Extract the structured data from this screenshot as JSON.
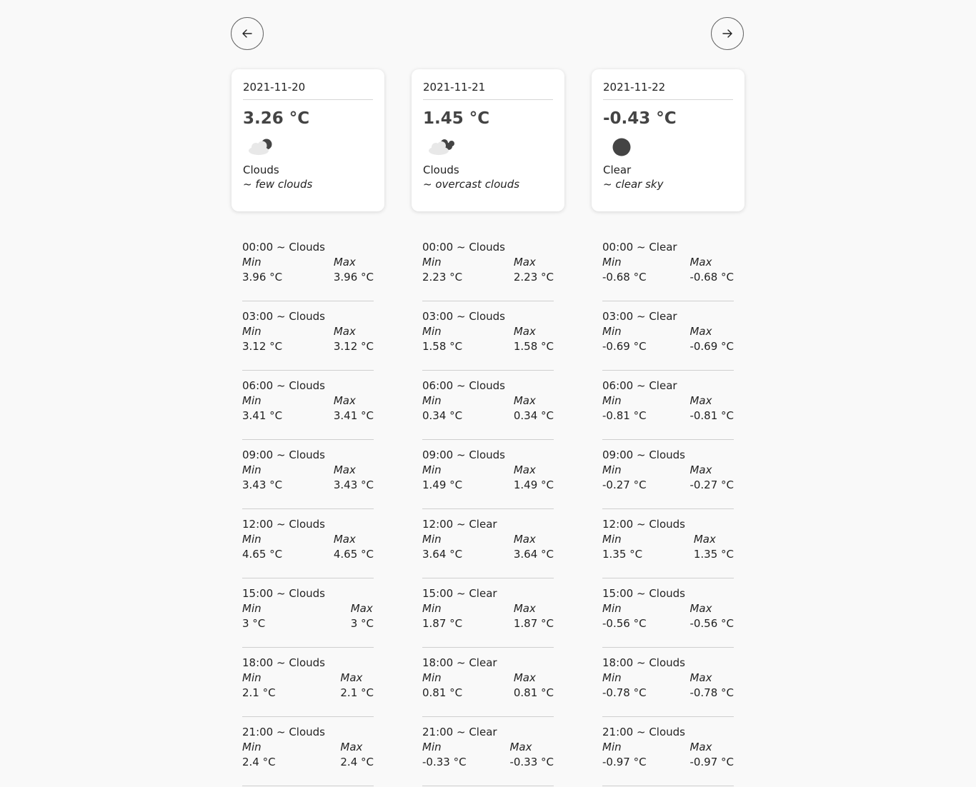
{
  "nav": {
    "prev_icon": "arrow-left-icon",
    "next_icon": "arrow-right-icon"
  },
  "days": [
    {
      "date": "2021-11-20",
      "temp": "3.26 °C",
      "icon": "few-clouds-icon",
      "main": "Clouds",
      "desc": "~ few clouds",
      "slots": [
        {
          "title": "00:00 ~ Clouds",
          "min_label": "Min",
          "max_label": "Max",
          "min": "3.96 °C",
          "max": "3.96 °C"
        },
        {
          "title": "03:00 ~ Clouds",
          "min_label": "Min",
          "max_label": "Max",
          "min": "3.12 °C",
          "max": "3.12 °C"
        },
        {
          "title": "06:00 ~ Clouds",
          "min_label": "Min",
          "max_label": "Max",
          "min": "3.41 °C",
          "max": "3.41 °C"
        },
        {
          "title": "09:00 ~ Clouds",
          "min_label": "Min",
          "max_label": "Max",
          "min": "3.43 °C",
          "max": "3.43 °C"
        },
        {
          "title": "12:00 ~ Clouds",
          "min_label": "Min",
          "max_label": "Max",
          "min": "4.65 °C",
          "max": "4.65 °C"
        },
        {
          "title": "15:00 ~ Clouds",
          "min_label": "Min",
          "max_label": "Max",
          "min": "3 °C",
          "max": "3 °C"
        },
        {
          "title": "18:00 ~ Clouds",
          "min_label": "Min",
          "max_label": "Max",
          "min": "2.1 °C",
          "max": "2.1 °C"
        },
        {
          "title": "21:00 ~ Clouds",
          "min_label": "Min",
          "max_label": "Max",
          "min": "2.4 °C",
          "max": "2.4 °C"
        }
      ]
    },
    {
      "date": "2021-11-21",
      "temp": "1.45 °C",
      "icon": "overcast-clouds-icon",
      "main": "Clouds",
      "desc": "~ overcast clouds",
      "slots": [
        {
          "title": "00:00 ~ Clouds",
          "min_label": "Min",
          "max_label": "Max",
          "min": "2.23 °C",
          "max": "2.23 °C"
        },
        {
          "title": "03:00 ~ Clouds",
          "min_label": "Min",
          "max_label": "Max",
          "min": "1.58 °C",
          "max": "1.58 °C"
        },
        {
          "title": "06:00 ~ Clouds",
          "min_label": "Min",
          "max_label": "Max",
          "min": "0.34 °C",
          "max": "0.34 °C"
        },
        {
          "title": "09:00 ~ Clouds",
          "min_label": "Min",
          "max_label": "Max",
          "min": "1.49 °C",
          "max": "1.49 °C"
        },
        {
          "title": "12:00 ~ Clear",
          "min_label": "Min",
          "max_label": "Max",
          "min": "3.64 °C",
          "max": "3.64 °C"
        },
        {
          "title": "15:00 ~ Clear",
          "min_label": "Min",
          "max_label": "Max",
          "min": "1.87 °C",
          "max": "1.87 °C"
        },
        {
          "title": "18:00 ~ Clear",
          "min_label": "Min",
          "max_label": "Max",
          "min": "0.81 °C",
          "max": "0.81 °C"
        },
        {
          "title": "21:00 ~ Clear",
          "min_label": "Min",
          "max_label": "Max",
          "min": "-0.33 °C",
          "max": "-0.33 °C"
        }
      ]
    },
    {
      "date": "2021-11-22",
      "temp": "-0.43 °C",
      "icon": "clear-sky-icon",
      "main": "Clear",
      "desc": "~ clear sky",
      "slots": [
        {
          "title": "00:00 ~ Clear",
          "min_label": "Min",
          "max_label": "Max",
          "min": "-0.68 °C",
          "max": "-0.68 °C"
        },
        {
          "title": "03:00 ~ Clear",
          "min_label": "Min",
          "max_label": "Max",
          "min": "-0.69 °C",
          "max": "-0.69 °C"
        },
        {
          "title": "06:00 ~ Clear",
          "min_label": "Min",
          "max_label": "Max",
          "min": "-0.81 °C",
          "max": "-0.81 °C"
        },
        {
          "title": "09:00 ~ Clouds",
          "min_label": "Min",
          "max_label": "Max",
          "min": "-0.27 °C",
          "max": "-0.27 °C"
        },
        {
          "title": "12:00 ~ Clouds",
          "min_label": "Min",
          "max_label": "Max",
          "min": "1.35 °C",
          "max": "1.35 °C"
        },
        {
          "title": "15:00 ~ Clouds",
          "min_label": "Min",
          "max_label": "Max",
          "min": "-0.56 °C",
          "max": "-0.56 °C"
        },
        {
          "title": "18:00 ~ Clouds",
          "min_label": "Min",
          "max_label": "Max",
          "min": "-0.78 °C",
          "max": "-0.78 °C"
        },
        {
          "title": "21:00 ~ Clouds",
          "min_label": "Min",
          "max_label": "Max",
          "min": "-0.97 °C",
          "max": "-0.97 °C"
        }
      ]
    }
  ]
}
